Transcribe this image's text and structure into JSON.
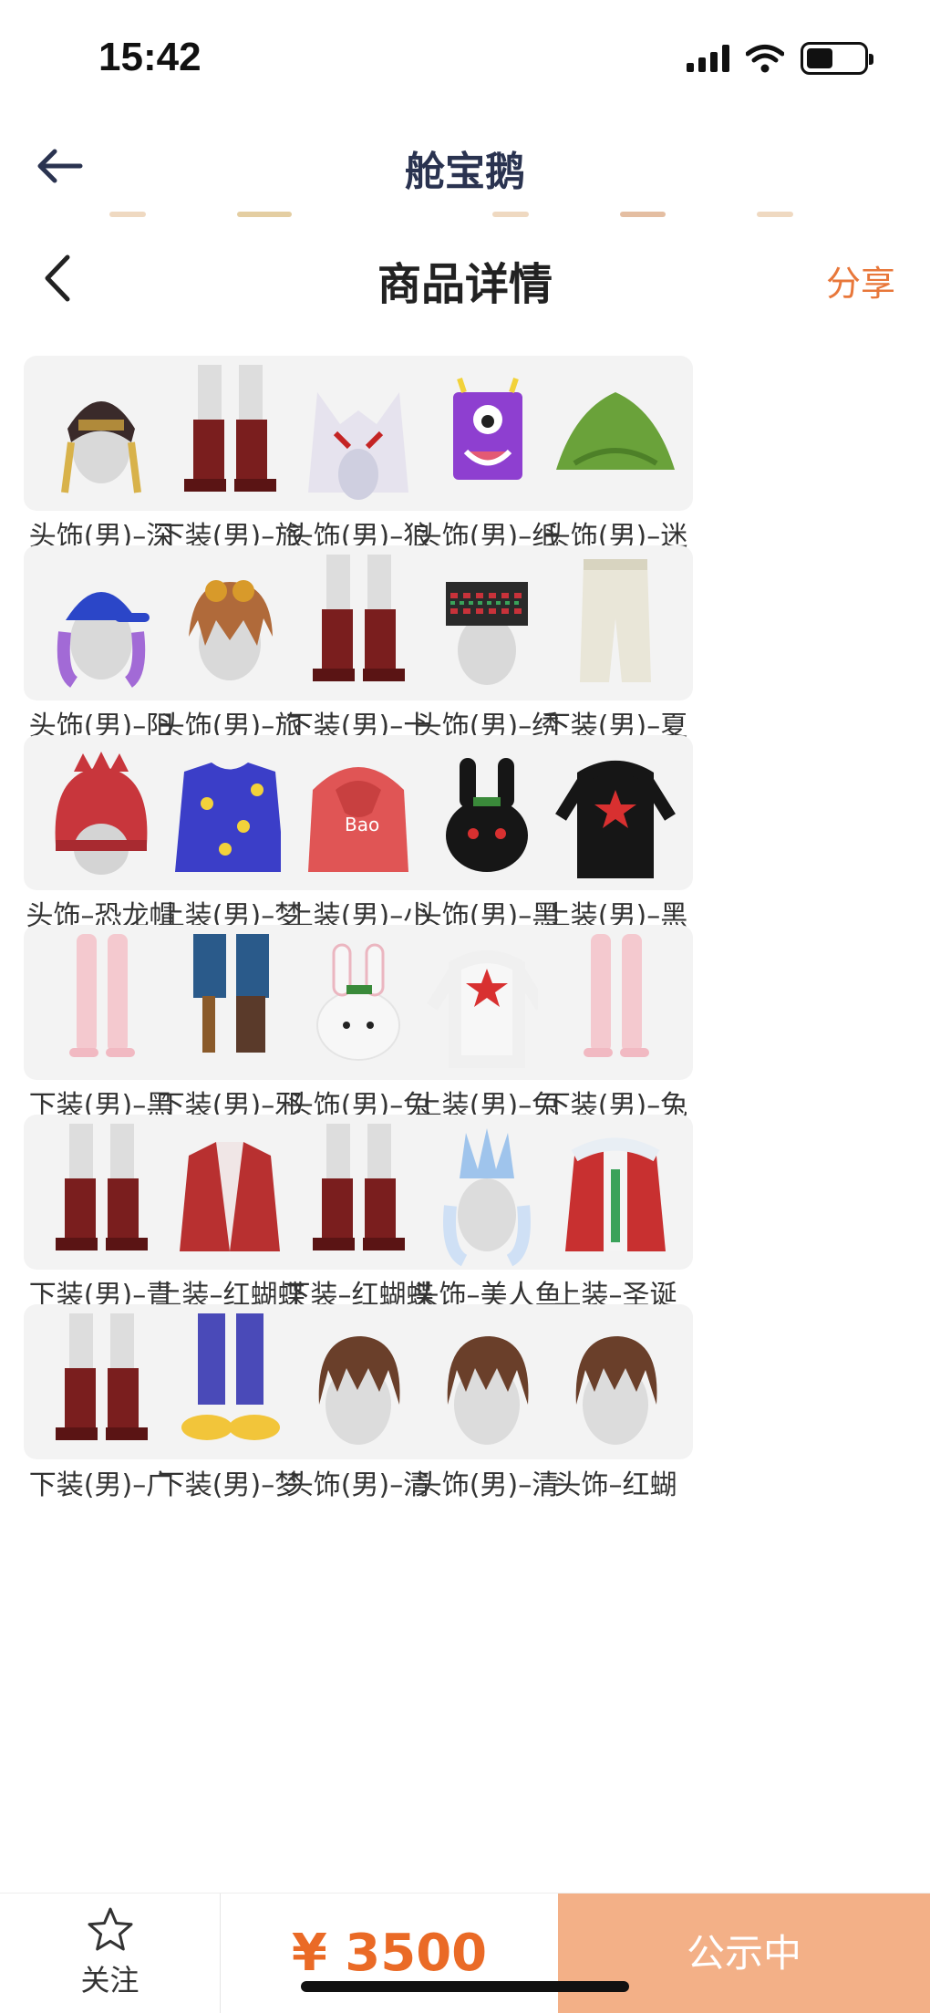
{
  "status_bar": {
    "time": "15:42"
  },
  "app_header": {
    "title": "舱宝鹅"
  },
  "detail_header": {
    "title": "商品详情",
    "share_label": "分享"
  },
  "items": [
    {
      "label": "头饰(男)–深渊盔甲",
      "icon": "helmet-icon"
    },
    {
      "label": "下装(男)–旅途之星",
      "icon": "boots-icon"
    },
    {
      "label": "头饰(男)–狼血蛮王",
      "icon": "wolf-head-icon"
    },
    {
      "label": "头饰(男)–纸袋",
      "icon": "paper-bag-icon"
    },
    {
      "label": "头饰(男)–迷彩暗影",
      "icon": "camo-bush-icon"
    },
    {
      "label": "头饰(男)–阳光高校",
      "icon": "cap-head-icon"
    },
    {
      "label": "头饰(男)–旅途之星",
      "icon": "goggles-head-icon"
    },
    {
      "label": "下装(男)–十里红妆",
      "icon": "boots-icon"
    },
    {
      "label": "头饰(男)–绣染苗疆",
      "icon": "embroidered-hat-icon"
    },
    {
      "label": "下装(男)–夏夜回旋曲",
      "icon": "pants-icon"
    },
    {
      "label": "头饰–恐龙帽",
      "icon": "dino-hat-icon"
    },
    {
      "label": "上装(男)–梦游先生",
      "icon": "pajama-top-icon"
    },
    {
      "label": "上装(男)–小爆哥",
      "icon": "hoodie-icon"
    },
    {
      "label": "头饰(男)–黑兔",
      "icon": "black-bunny-icon"
    },
    {
      "label": "上装(男)–黑兔",
      "icon": "black-suit-icon"
    },
    {
      "label": "下装(男)–黑兔",
      "icon": "legs-icon"
    },
    {
      "label": "下装(男)–邪恶海盗",
      "icon": "pirate-legs-icon"
    },
    {
      "label": "头饰(男)–兔子",
      "icon": "white-bunny-icon"
    },
    {
      "label": "上装(男)–兔子",
      "icon": "white-suit-icon"
    },
    {
      "label": "下装(男)–兔子",
      "icon": "legs-icon"
    },
    {
      "label": "下装(男)–青萝",
      "icon": "boots-icon"
    },
    {
      "label": "上装–红蝴蝶衣",
      "icon": "red-coat-icon"
    },
    {
      "label": "下装–红蝴蝶裤",
      "icon": "boots-icon"
    },
    {
      "label": "头饰–美人鱼之冠",
      "icon": "crown-head-icon"
    },
    {
      "label": "上装–圣诞",
      "icon": "christmas-coat-icon"
    },
    {
      "label": "下装(男)–广",
      "icon": "boots-icon"
    },
    {
      "label": "下装(男)–梦",
      "icon": "slippers-icon"
    },
    {
      "label": "头饰(男)–清",
      "icon": "hair-head-icon"
    },
    {
      "label": "头饰(男)–清",
      "icon": "hair-head-icon"
    },
    {
      "label": "头饰–红蝴",
      "icon": "hair-head-icon"
    }
  ],
  "bottom_bar": {
    "follow_label": "关注",
    "price": "¥ 3500",
    "status_label": "公示中"
  },
  "colors": {
    "accent": "#e8773a",
    "price": "#ea6a26",
    "status_button": "#f3b087"
  }
}
